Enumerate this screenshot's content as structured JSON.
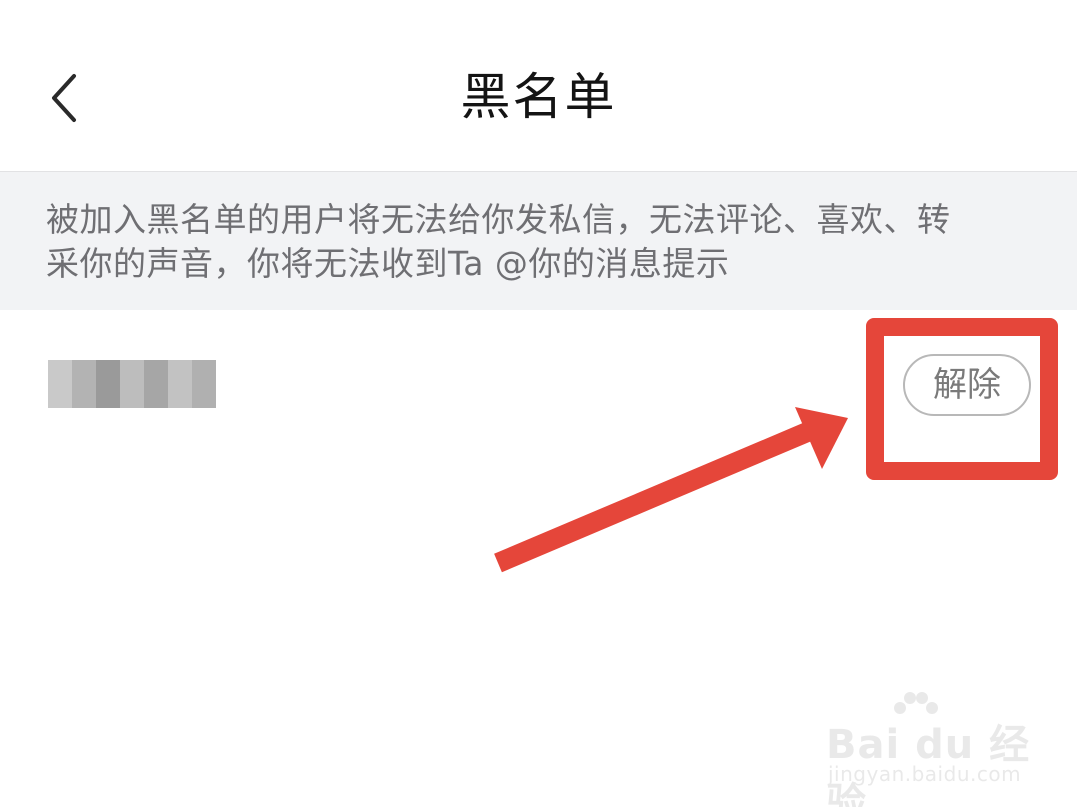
{
  "header": {
    "back_icon": "chevron-left-icon",
    "title": "黑名单"
  },
  "notice": {
    "text_line1": "被加入黑名单的用户将无法给你发私信，无法评论、喜欢、转",
    "text_line2": "采你的声音，你将无法收到Ta @你的消息提示"
  },
  "blocked_list": [
    {
      "name_blurred": true,
      "unblock_label": "解除"
    }
  ],
  "annotation": {
    "highlight_color": "#e5463a",
    "arrow_color": "#e5463a"
  },
  "watermark": {
    "logo_text": "Bai du 经验",
    "url": "jingyan.baidu.com"
  }
}
